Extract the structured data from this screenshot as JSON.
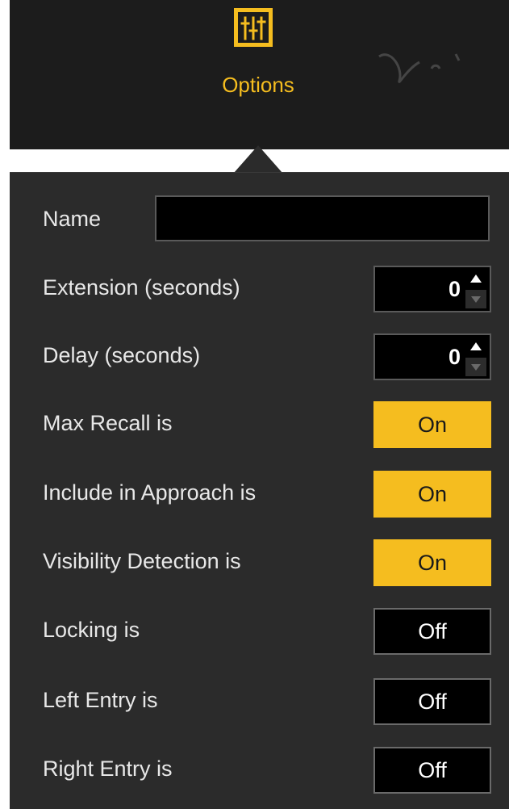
{
  "header": {
    "options_label": "Options",
    "options_icon": "sliders-icon",
    "accent_color": "#f5bd1f"
  },
  "form": {
    "name": {
      "label": "Name",
      "value": ""
    },
    "extension": {
      "label": "Extension (seconds)",
      "value": "0"
    },
    "delay": {
      "label": "Delay (seconds)",
      "value": "0"
    },
    "toggles": [
      {
        "label": "Max Recall is",
        "state": "On"
      },
      {
        "label": "Include in Approach is",
        "state": "On"
      },
      {
        "label": "Visibility Detection is",
        "state": "On"
      },
      {
        "label": "Locking is",
        "state": "Off"
      },
      {
        "label": "Left Entry is",
        "state": "Off"
      },
      {
        "label": "Right Entry is",
        "state": "Off"
      }
    ]
  }
}
